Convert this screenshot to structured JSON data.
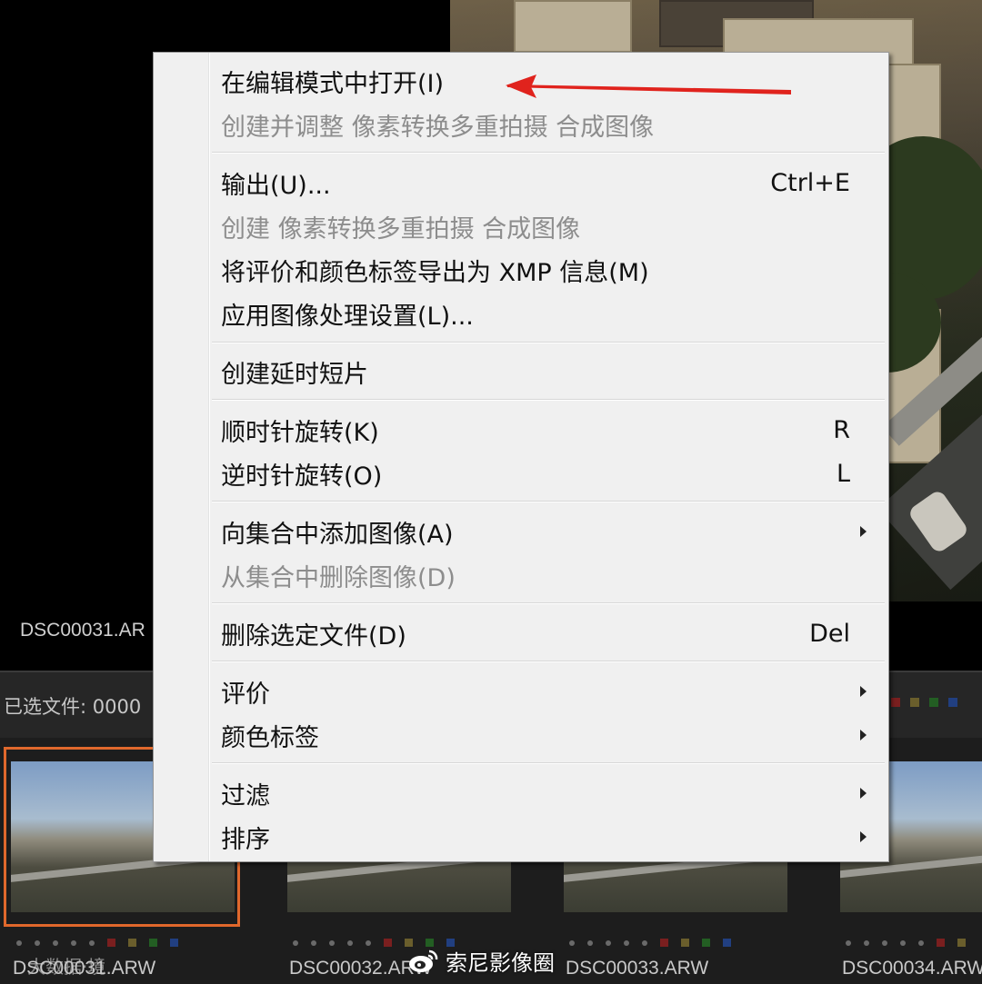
{
  "background": {
    "main_photo_caption": "DSC00031.AR",
    "status": {
      "selected_files_text": "已选文件: 0000"
    },
    "thumbnails": [
      {
        "caption": "DSC00031.ARW",
        "selected": true
      },
      {
        "caption": "DSC00032.ARW",
        "selected": false
      },
      {
        "caption": "DSC00033.ARW",
        "selected": false
      },
      {
        "caption": "DSC00034.ARW",
        "selected": false
      }
    ],
    "color_labels": [
      "#a02424",
      "#8a7a3a",
      "#2c7a2c",
      "#2a4fa0"
    ],
    "selection_color": "#e0682c"
  },
  "menu": {
    "items": [
      {
        "label": "在编辑模式中打开(I)",
        "shortcut": "",
        "disabled": false,
        "submenu": false
      },
      {
        "label": "创建并调整 像素转换多重拍摄 合成图像",
        "shortcut": "",
        "disabled": true,
        "submenu": false
      },
      {
        "label": "输出(U)...",
        "shortcut": "Ctrl+E",
        "disabled": false,
        "submenu": false
      },
      {
        "label": "创建 像素转换多重拍摄 合成图像",
        "shortcut": "",
        "disabled": true,
        "submenu": false
      },
      {
        "label": "将评价和颜色标签导出为 XMP 信息(M)",
        "shortcut": "",
        "disabled": false,
        "submenu": false
      },
      {
        "label": "应用图像处理设置(L)...",
        "shortcut": "",
        "disabled": false,
        "submenu": false
      },
      {
        "label": "创建延时短片",
        "shortcut": "",
        "disabled": false,
        "submenu": false
      },
      {
        "label": "顺时针旋转(K)",
        "shortcut": "R",
        "disabled": false,
        "submenu": false
      },
      {
        "label": "逆时针旋转(O)",
        "shortcut": "L",
        "disabled": false,
        "submenu": false
      },
      {
        "label": "向集合中添加图像(A)",
        "shortcut": "",
        "disabled": false,
        "submenu": true
      },
      {
        "label": "从集合中删除图像(D)",
        "shortcut": "",
        "disabled": true,
        "submenu": false
      },
      {
        "label": "删除选定文件(D)",
        "shortcut": "Del",
        "disabled": false,
        "submenu": false
      },
      {
        "label": "评价",
        "shortcut": "",
        "disabled": false,
        "submenu": true
      },
      {
        "label": "颜色标签",
        "shortcut": "",
        "disabled": false,
        "submenu": true
      },
      {
        "label": "过滤",
        "shortcut": "",
        "disabled": false,
        "submenu": true
      },
      {
        "label": "排序",
        "shortcut": "",
        "disabled": false,
        "submenu": true
      }
    ],
    "annotation_color": "#e0231d"
  },
  "watermarks": {
    "left": "大数据·境",
    "weibo": "索尼影像圈"
  }
}
